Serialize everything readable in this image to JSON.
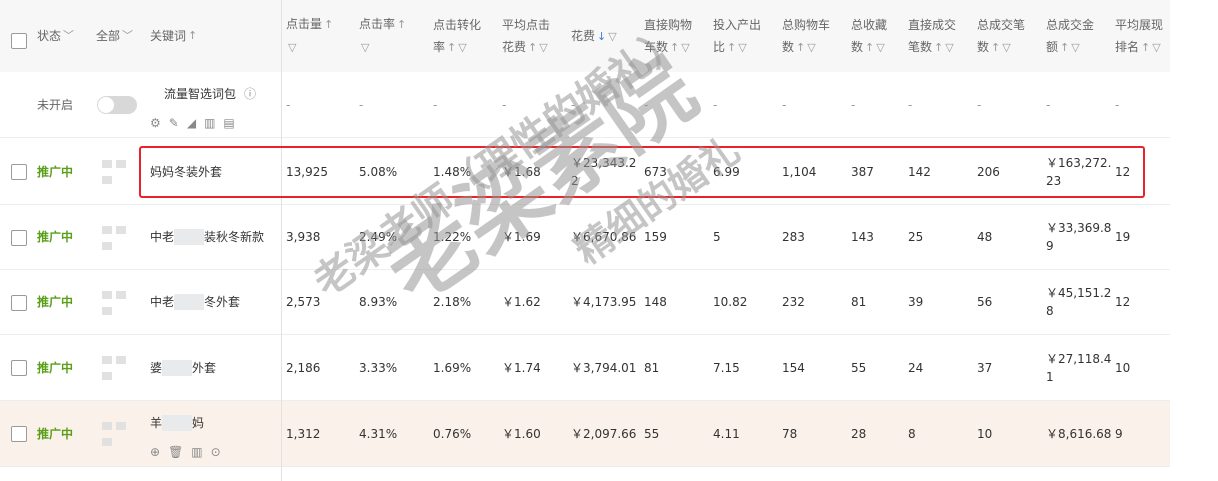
{
  "header": {
    "status": "状态",
    "all": "全部",
    "keyword": "关键词",
    "columns": [
      {
        "l1": "点击量",
        "l2": ""
      },
      {
        "l1": "点击率",
        "l2": ""
      },
      {
        "l1": "点击转化",
        "l2": "率"
      },
      {
        "l1": "平均点击",
        "l2": "花费"
      },
      {
        "l1": "花费",
        "l2": ""
      },
      {
        "l1": "直接购物",
        "l2": "车数"
      },
      {
        "l1": "投入产出",
        "l2": "比"
      },
      {
        "l1": "总购物车",
        "l2": "数"
      },
      {
        "l1": "总收藏",
        "l2": "数"
      },
      {
        "l1": "直接成交",
        "l2": "笔数"
      },
      {
        "l1": "总成交笔",
        "l2": "数"
      },
      {
        "l1": "总成交金",
        "l2": "额"
      },
      {
        "l1": "平均展现",
        "l2": "排名"
      }
    ]
  },
  "pack_row": {
    "status": "未开启",
    "name": "流量智选词包",
    "dash": "-"
  },
  "rows": [
    {
      "status": "推广中",
      "kw_a": "妈妈冬装外套",
      "kw_b": "",
      "cells": [
        "13,925",
        "5.08%",
        "1.48%",
        "￥1.68",
        "￥23,343.2\n2",
        "673",
        "6.99",
        "1,104",
        "387",
        "142",
        "206",
        "￥163,272.\n23",
        "12"
      ]
    },
    {
      "status": "推广中",
      "kw_a": "中老",
      "kw_b": "装秋冬新款",
      "cells": [
        "3,938",
        "2.49%",
        "1.22%",
        "￥1.69",
        "￥6,670.86",
        "159",
        "5",
        "283",
        "143",
        "25",
        "48",
        "￥33,369.8\n9",
        "19"
      ]
    },
    {
      "status": "推广中",
      "kw_a": "中老",
      "kw_b": "冬外套",
      "cells": [
        "2,573",
        "8.93%",
        "2.18%",
        "￥1.62",
        "￥4,173.95",
        "148",
        "10.82",
        "232",
        "81",
        "39",
        "56",
        "￥45,151.2\n8",
        "12"
      ]
    },
    {
      "status": "推广中",
      "kw_a": "婆",
      "kw_b": "外套",
      "cells": [
        "2,186",
        "3.33%",
        "1.69%",
        "￥1.74",
        "￥3,794.01",
        "81",
        "7.15",
        "154",
        "55",
        "24",
        "37",
        "￥27,118.4\n1",
        "10"
      ]
    },
    {
      "status": "推广中",
      "kw_a": "羊",
      "kw_b": "妈",
      "cells": [
        "1,312",
        "4.31%",
        "0.76%",
        "￥1.60",
        "￥2,097.66",
        "55",
        "4.11",
        "78",
        "28",
        "8",
        "10",
        "￥8,616.68",
        "9"
      ]
    }
  ],
  "watermark": {
    "big": "老梁素院",
    "mid": "精细的婚礼",
    "small": "老梁老师（理性的婚礼）"
  }
}
